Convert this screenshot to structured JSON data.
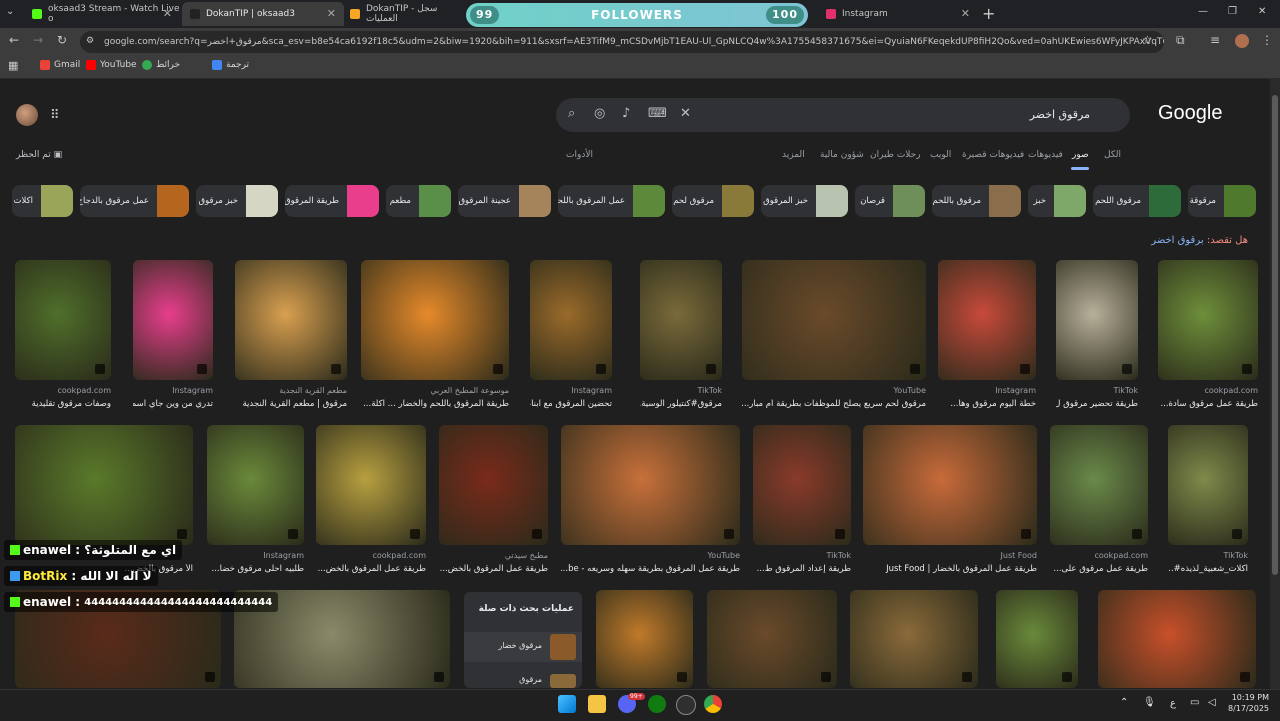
{
  "browser": {
    "tabs": [
      {
        "title": "oksaad3 Stream - Watch Live o",
        "color": "#53fc18"
      },
      {
        "title": "DokanTIP | oksaad3",
        "color": "#222222"
      },
      {
        "title": "DokanTIP - سجل العمليات",
        "color": "#f5a623"
      },
      {
        "title": "Instagram",
        "color": "#e1306c"
      }
    ],
    "new_tab": "+",
    "window_controls": [
      "—",
      "❐",
      "✕"
    ],
    "address": "google.com/search?q=مرقوق+اخضر&sca_esv=b8e54ca6192f18c5&udm=2&biw=1920&bih=911&sxsrf=AE3TifM9_mCSDvMjbT1EAU-Ul_GpNLCQ4w%3A1755458371675&ei=QyuiaN6FKeqekdUP8fiH2Qo&ved=0ahUKEwies6WFyJKPAxVqT6QEHXH8I..."
  },
  "followers_overlay": {
    "left": "99",
    "label": "FOLLOWERS",
    "right": "100"
  },
  "bookmarks": [
    {
      "label": "Gmail",
      "color": "#ea4335"
    },
    {
      "label": "YouTube",
      "color": "#ff0000"
    },
    {
      "label": "خرائط",
      "color": "#34a853"
    },
    {
      "label": "ترجمة",
      "color": "#4285f4"
    }
  ],
  "google": {
    "logo": "Google",
    "query": "مرقوق اخضر",
    "tabs": [
      "الكل",
      "صور",
      "فيديوهات",
      "فيديوهات قصيرة",
      "الويب",
      "رحلات طيران",
      "شؤون مالية",
      "المزيد"
    ],
    "active_tab": "صور",
    "tools": "الأدوات",
    "safe_search": "تم الحظر",
    "did_you_mean_label": "هل تقصد:",
    "did_you_mean_query": "برقوق اخضر",
    "chips": [
      {
        "label": "مرقوقة",
        "color": "#4f7a2e"
      },
      {
        "label": "مرقوق اللحم",
        "color": "#2e6b3a"
      },
      {
        "label": "خبز",
        "color": "#7ea86a"
      },
      {
        "label": "مرقوق باللحم",
        "color": "#8a6d4b"
      },
      {
        "label": "قرصان",
        "color": "#6f8f5a"
      },
      {
        "label": "خبز المرقوق",
        "color": "#b8c4b0"
      },
      {
        "label": "مرقوق لحم",
        "color": "#8a7a3a"
      },
      {
        "label": "عمل المرقوق باللحم",
        "color": "#5d8a3a"
      },
      {
        "label": "عجينة المرقوق",
        "color": "#a5835b"
      },
      {
        "label": "مطعم",
        "color": "#5a8f4a"
      },
      {
        "label": "طريقة المرقوق",
        "color": "#e83e8c"
      },
      {
        "label": "خبز مرقوق",
        "color": "#d6d6c4"
      },
      {
        "label": "عمل مرقوق بالدجاج",
        "color": "#b5651d"
      },
      {
        "label": "اكلات",
        "color": "#9aa55a"
      }
    ],
    "results_row1": [
      {
        "source": "cookpad.com",
        "title": "طريقة عمل مرقوق سادة...",
        "color": "#6e8f3a"
      },
      {
        "source": "TikTok",
        "title": "طريقة تحضير مرقوق ل...",
        "color": "#b8b09a"
      },
      {
        "source": "Instagram",
        "title": "خطة اليوم مرقوق وها...",
        "color": "#c84a3a"
      },
      {
        "source": "YouTube",
        "title": "مرقوق لحم سريع يصلح للموظفات بطريقة ام مبار...",
        "color": "#6a4a2a"
      },
      {
        "source": "TikTok",
        "title": "مرقوق#كنتيلور الوسية...",
        "color": "#7a6a3a"
      },
      {
        "source": "Instagram",
        "title": "تحضين المرقوق مع ابنام...",
        "color": "#9a6a2a"
      },
      {
        "source": "موسوعة المطبخ العربي",
        "title": "طريقة المرقوق باللحم والخضار ... اكلة...",
        "color": "#e68a2a"
      },
      {
        "source": "مطعم القرية النجدية",
        "title": "مرقوق | مطعم القرية النجدية",
        "color": "#d9a050"
      },
      {
        "source": "Instagram",
        "title": "تدري من وين جاي اسم...",
        "color": "#e83e8c"
      },
      {
        "source": "cookpad.com",
        "title": "وصفات مرقوق تقليدية",
        "color": "#4f6f2a"
      }
    ],
    "results_row2": [
      {
        "source": "TikTok",
        "title": "اكلات_شعبية_لذيذه#...",
        "color": "#7f8a4a"
      },
      {
        "source": "cookpad.com",
        "title": "طريقة عمل مرقوق على...",
        "color": "#6a8a4a"
      },
      {
        "source": "Just Food",
        "title": "طريقة عمل المرقوق بالخضار | Just Food",
        "color": "#c86a3a"
      },
      {
        "source": "TikTok",
        "title": "طريقة إعداد المرقوق ط...",
        "color": "#8a3a2a"
      },
      {
        "source": "YouTube",
        "title": "طريقة عمل المرقوق بطريقة سهله وسريعه - be...",
        "color": "#c8703a"
      },
      {
        "source": "مطبخ سيدتي",
        "title": "طريقة عمل المرقوق بالخض...",
        "color": "#7a2a1a"
      },
      {
        "source": "cookpad.com",
        "title": "طريقة عمل المرقوق بالخض...",
        "color": "#b8a040"
      },
      {
        "source": "Instagram",
        "title": "طلبيه احلى مرقوق خضا...",
        "color": "#6a8a3a"
      },
      {
        "source": "",
        "title": "الأ مرقوق بالخض...",
        "color": "#5a7a2a"
      }
    ],
    "results_row3": [
      {
        "color": "#c8502a"
      },
      {
        "color": "#6a8a3a"
      },
      {
        "color": "#8a6a3a"
      },
      {
        "color": "#6a4a2a"
      },
      {
        "color": "#c07a2a"
      },
      {
        "color": "#8a8a6a"
      },
      {
        "color": "#5a2a1a"
      }
    ],
    "related": {
      "title": "عمليات بحث ذات صلة",
      "items": [
        "مرقوق خضار",
        "مرقوق"
      ]
    }
  },
  "chat": [
    {
      "user": "enawel",
      "message": "اي مع المتلوثة؟"
    },
    {
      "user": "BotRix",
      "message": "لا اله الا الله"
    },
    {
      "user": "enawel",
      "message": "444444444444444444444444444"
    }
  ],
  "taskbar": {
    "time": "10:19 PM",
    "date": "8/17/2025",
    "lang": "ع",
    "badge": "99+"
  }
}
